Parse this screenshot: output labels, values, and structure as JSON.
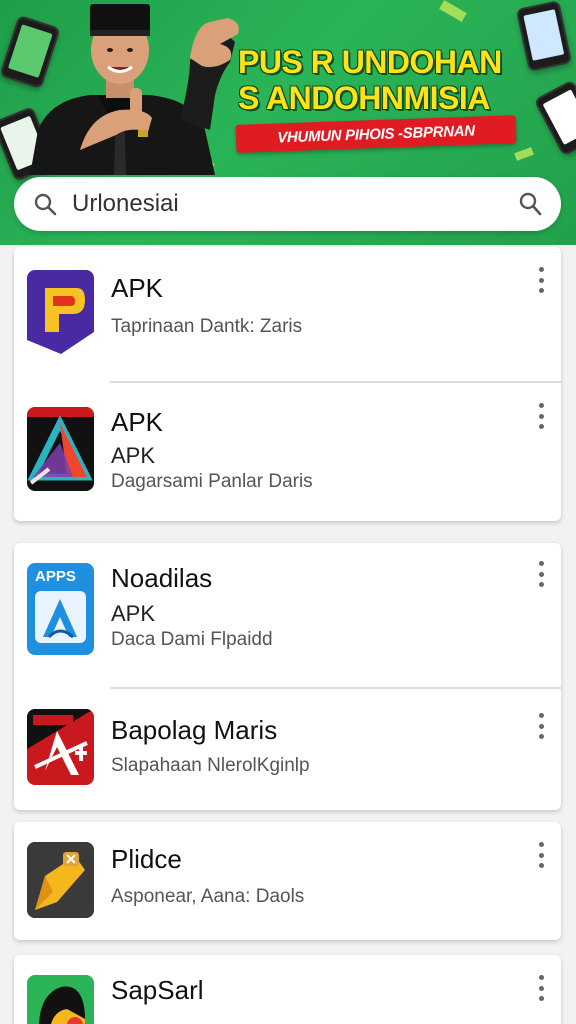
{
  "banner": {
    "headline_line1": "PUS R UNDOHAN",
    "headline_line2": "S ANDOHNMISIA",
    "ribbon_text": "VHUMUN PIHOIS -SBPRNAN",
    "colors": {
      "background": "#2bb457",
      "headline": "#ffe21a",
      "ribbon": "#e11b22"
    }
  },
  "search": {
    "query": "Urlonesiai",
    "left_icon": "search-icon",
    "right_icon": "user-search-icon"
  },
  "cards": [
    {
      "items": [
        {
          "icon": "purple-play-logo",
          "title": "APK",
          "subtitle": "",
          "meta": "Taprinaan Dantk: Zaris"
        },
        {
          "icon": "red-triangle-logo",
          "title": "APK",
          "subtitle": "APK",
          "meta": "Dagarsami Panlar Daris"
        }
      ]
    },
    {
      "items": [
        {
          "icon": "apps-blue-logo",
          "icon_label": "APPS",
          "title": "Noadilas",
          "subtitle": "APK",
          "meta": "Daca Dami Flpaidd"
        },
        {
          "icon": "red-a-logo",
          "title": "Bapolag Maris",
          "subtitle": "",
          "meta": "Slapahaan NlerolKginlp"
        }
      ]
    },
    {
      "items": [
        {
          "icon": "yellow-pencil-logo",
          "title": "Plidce",
          "subtitle": "",
          "meta": "Asponear, Aana: Daols"
        }
      ]
    },
    {
      "items": [
        {
          "icon": "green-blob-logo",
          "title": "SapSarl",
          "subtitle": "",
          "meta": ""
        }
      ]
    }
  ]
}
